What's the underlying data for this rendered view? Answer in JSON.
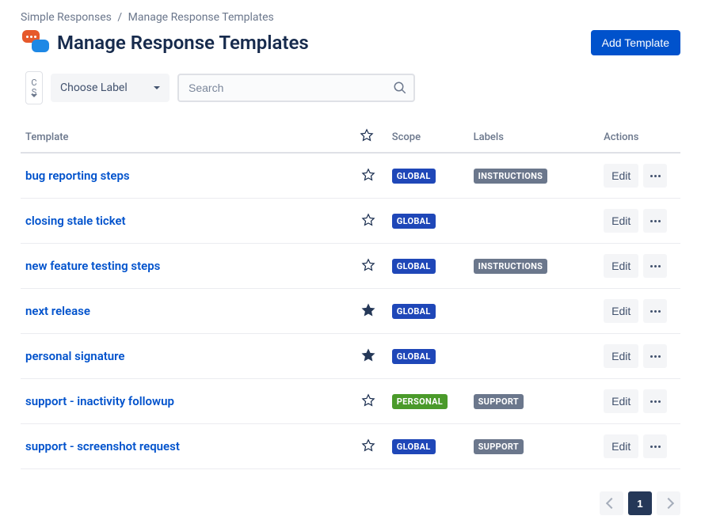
{
  "breadcrumb": {
    "parent": "Simple Responses",
    "current": "Manage Response Templates"
  },
  "page_title": "Manage Response Templates",
  "add_button": "Add Template",
  "filters": {
    "scope_abbrev_line1": "C",
    "scope_abbrev_line2": "S",
    "label_placeholder": "Choose Label",
    "search_placeholder": "Search"
  },
  "columns": {
    "template": "Template",
    "scope": "Scope",
    "labels": "Labels",
    "actions": "Actions"
  },
  "scope_badges": {
    "GLOBAL": "GLOBAL",
    "PERSONAL": "PERSONAL"
  },
  "label_badges": {
    "INSTRUCTIONS": "INSTRUCTIONS",
    "SUPPORT": "SUPPORT"
  },
  "edit_label": "Edit",
  "rows": [
    {
      "name": "bug reporting steps",
      "starred": false,
      "scope": "GLOBAL",
      "labels": [
        "INSTRUCTIONS"
      ]
    },
    {
      "name": "closing stale ticket",
      "starred": false,
      "scope": "GLOBAL",
      "labels": []
    },
    {
      "name": "new feature testing steps",
      "starred": false,
      "scope": "GLOBAL",
      "labels": [
        "INSTRUCTIONS"
      ]
    },
    {
      "name": "next release",
      "starred": true,
      "scope": "GLOBAL",
      "labels": []
    },
    {
      "name": "personal signature",
      "starred": true,
      "scope": "GLOBAL",
      "labels": []
    },
    {
      "name": "support - inactivity followup",
      "starred": false,
      "scope": "PERSONAL",
      "labels": [
        "SUPPORT"
      ]
    },
    {
      "name": "support - screenshot request",
      "starred": false,
      "scope": "GLOBAL",
      "labels": [
        "SUPPORT"
      ]
    }
  ],
  "pagination": {
    "current": "1"
  }
}
